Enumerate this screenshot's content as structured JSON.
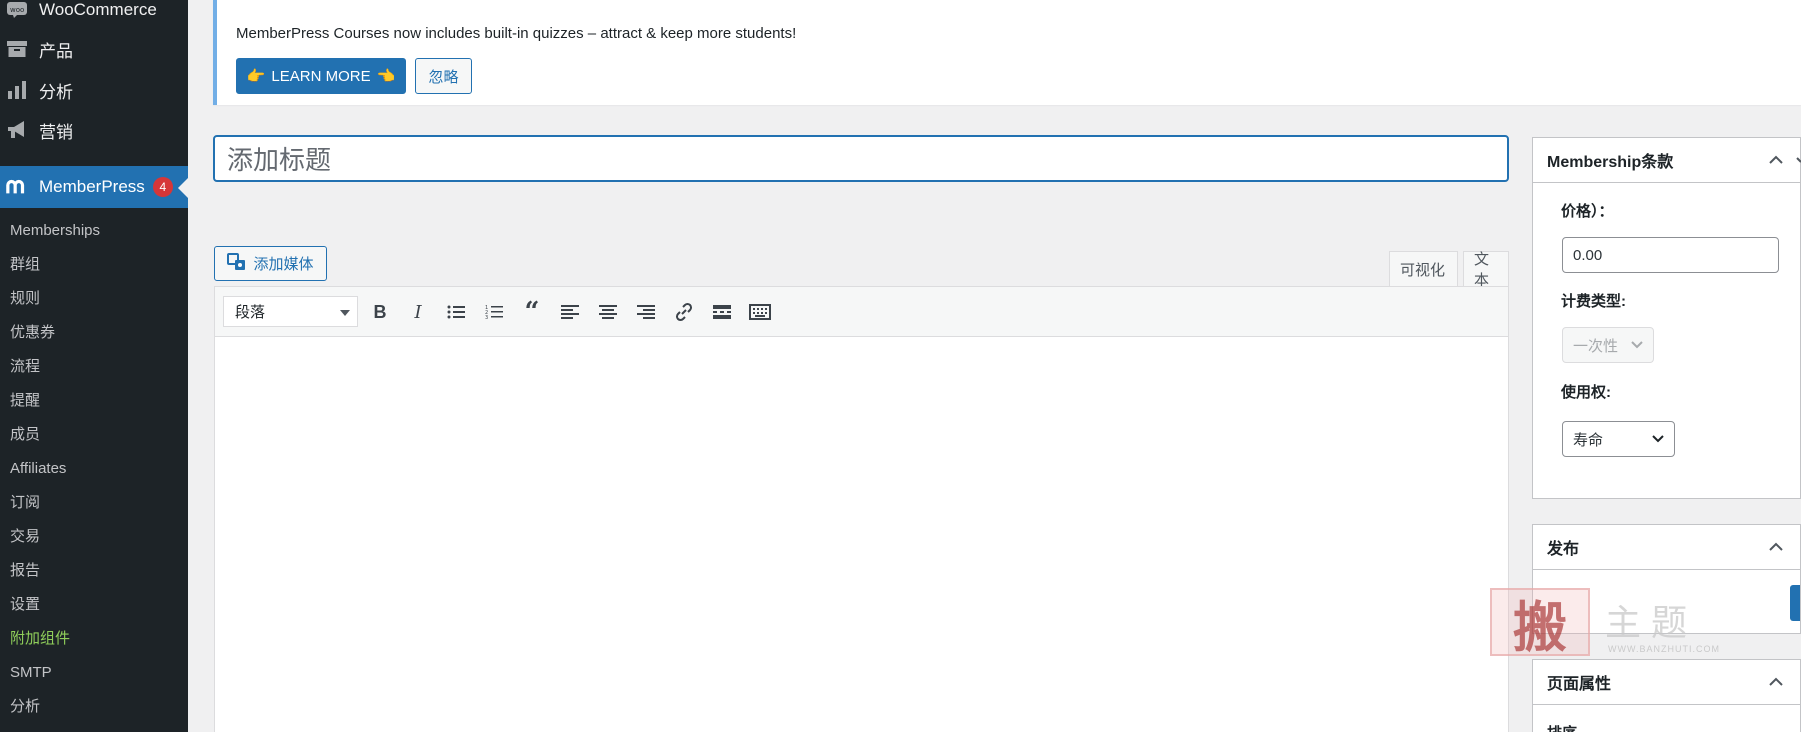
{
  "sidebar": {
    "top_items": [
      {
        "label": "WooCommerce",
        "icon": "woo-icon"
      },
      {
        "label": "产品",
        "icon": "archive-icon"
      },
      {
        "label": "分析",
        "icon": "bar-chart-icon"
      },
      {
        "label": "营销",
        "icon": "megaphone-icon"
      }
    ],
    "memberpress": {
      "label": "MemberPress",
      "badge": "4",
      "icon": "memberpress-logo-icon"
    },
    "submenu": [
      {
        "label": "Memberships"
      },
      {
        "label": "群组"
      },
      {
        "label": "规则"
      },
      {
        "label": "优惠券"
      },
      {
        "label": "流程"
      },
      {
        "label": "提醒"
      },
      {
        "label": "成员"
      },
      {
        "label": "Affiliates"
      },
      {
        "label": "订阅"
      },
      {
        "label": "交易"
      },
      {
        "label": "报告"
      },
      {
        "label": "设置"
      },
      {
        "label": "附加组件"
      },
      {
        "label": "SMTP"
      },
      {
        "label": "分析"
      }
    ]
  },
  "notice": {
    "text": "MemberPress Courses now includes built-in quizzes – attract & keep more students!",
    "learn_more": "LEARN MORE",
    "ignore": "忽略"
  },
  "editor": {
    "title_placeholder": "添加标题",
    "add_media": "添加媒体",
    "tab_visual": "可视化",
    "tab_text": "文本",
    "format_value": "段落"
  },
  "membership_terms": {
    "title": "Membership条款",
    "price_label": "价格）：",
    "price_value": "0.00",
    "billing_type_label": "计费类型:",
    "billing_type_value": "一次性",
    "access_label": "使用权:",
    "access_value": "寿命"
  },
  "publish": {
    "title": "发布"
  },
  "page_attributes": {
    "title": "页面属性",
    "order_label": "排序"
  },
  "watermark": {
    "seal": "搬",
    "text": "主题",
    "url": "WWW.BANZHUTI.COM"
  },
  "colors": {
    "accent": "#2271b1",
    "sidebar_bg": "#1d2327",
    "badge": "#d63638",
    "highlight": "#8fce5a"
  }
}
